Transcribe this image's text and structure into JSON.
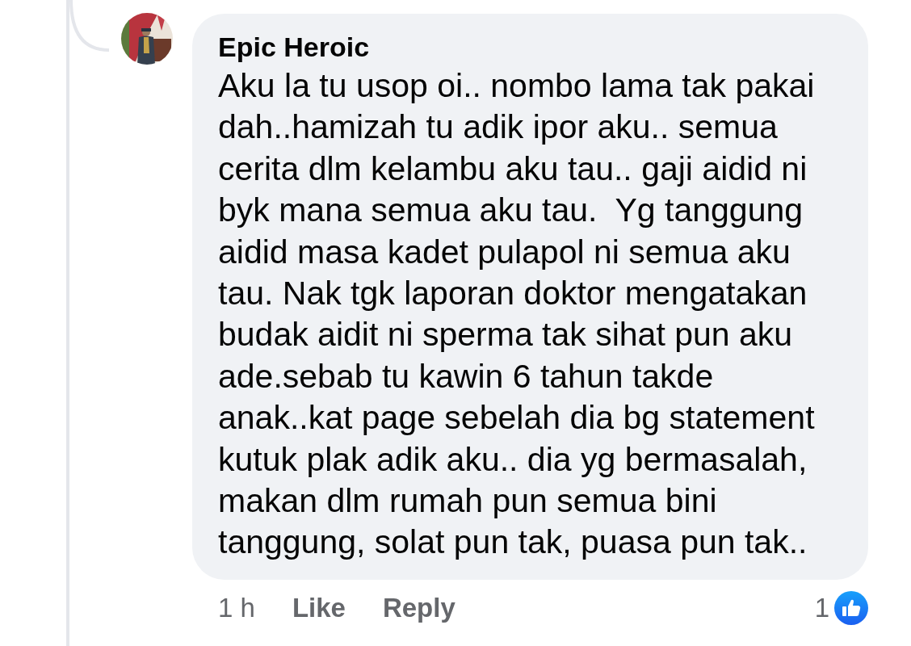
{
  "comment": {
    "author": "Epic Heroic",
    "text": "Aku la tu usop oi.. nombo lama tak pakai\ndah..hamizah tu adik ipor aku.. semua\ncerita dlm kelambu aku tau.. gaji aidid ni\nbyk mana semua aku tau.  Yg tanggung\naidid masa kadet pulapol ni semua aku\ntau. Nak tgk laporan doktor mengatakan\nbudak aidit ni sperma tak sihat pun aku\nade.sebab tu kawin 6 tahun takde\nanak..kat page sebelah dia bg statement\nkutuk plak adik aku.. dia yg bermasalah,\nmakan dlm rumah pun semua bini\ntanggung, solat pun tak, puasa pun tak..",
    "time": "1 h",
    "actions": [
      "Like",
      "Reply"
    ],
    "reaction_count": "1"
  }
}
